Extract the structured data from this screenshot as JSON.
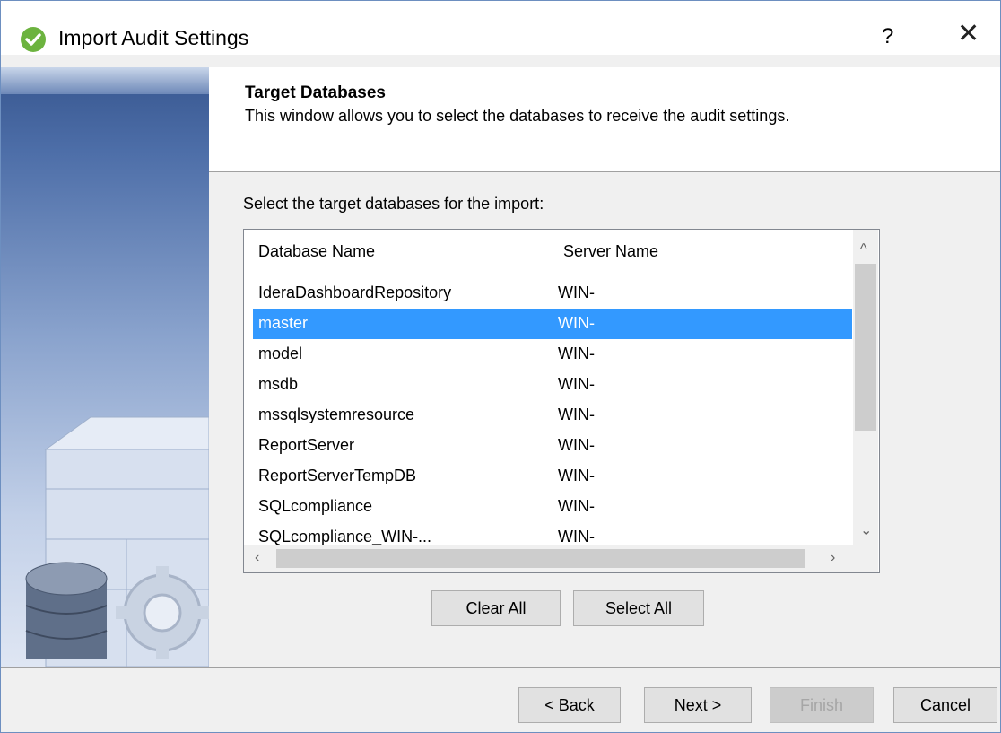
{
  "window": {
    "title": "Import Audit Settings",
    "help_label": "?",
    "close_label": "✕"
  },
  "header": {
    "title": "Target Databases",
    "description": "This window allows you to select the databases to receive the audit settings."
  },
  "instruction": "Select the target databases for the import:",
  "list": {
    "columns": [
      "Database Name",
      "Server Name"
    ],
    "rows": [
      {
        "db": "IderaDashboardRepository",
        "server": "WIN-"
      },
      {
        "db": "master",
        "server": "WIN-",
        "selected": true
      },
      {
        "db": "model",
        "server": "WIN-"
      },
      {
        "db": "msdb",
        "server": "WIN-"
      },
      {
        "db": "mssqlsystemresource",
        "server": "WIN-"
      },
      {
        "db": "ReportServer",
        "server": "WIN-"
      },
      {
        "db": "ReportServerTempDB",
        "server": "WIN-"
      },
      {
        "db": "SQLcompliance",
        "server": "WIN-"
      },
      {
        "db": "SQLcompliance_WIN-...",
        "server": "WIN-"
      }
    ],
    "selection_color": "#3399ff"
  },
  "actions": {
    "clear_all": "Clear All",
    "select_all": "Select All"
  },
  "footer": {
    "back": "< Back",
    "next": "Next >",
    "finish": "Finish",
    "cancel": "Cancel"
  },
  "icons": {
    "app": "green-check-circle-icon",
    "banner": "database-gear-icon"
  }
}
